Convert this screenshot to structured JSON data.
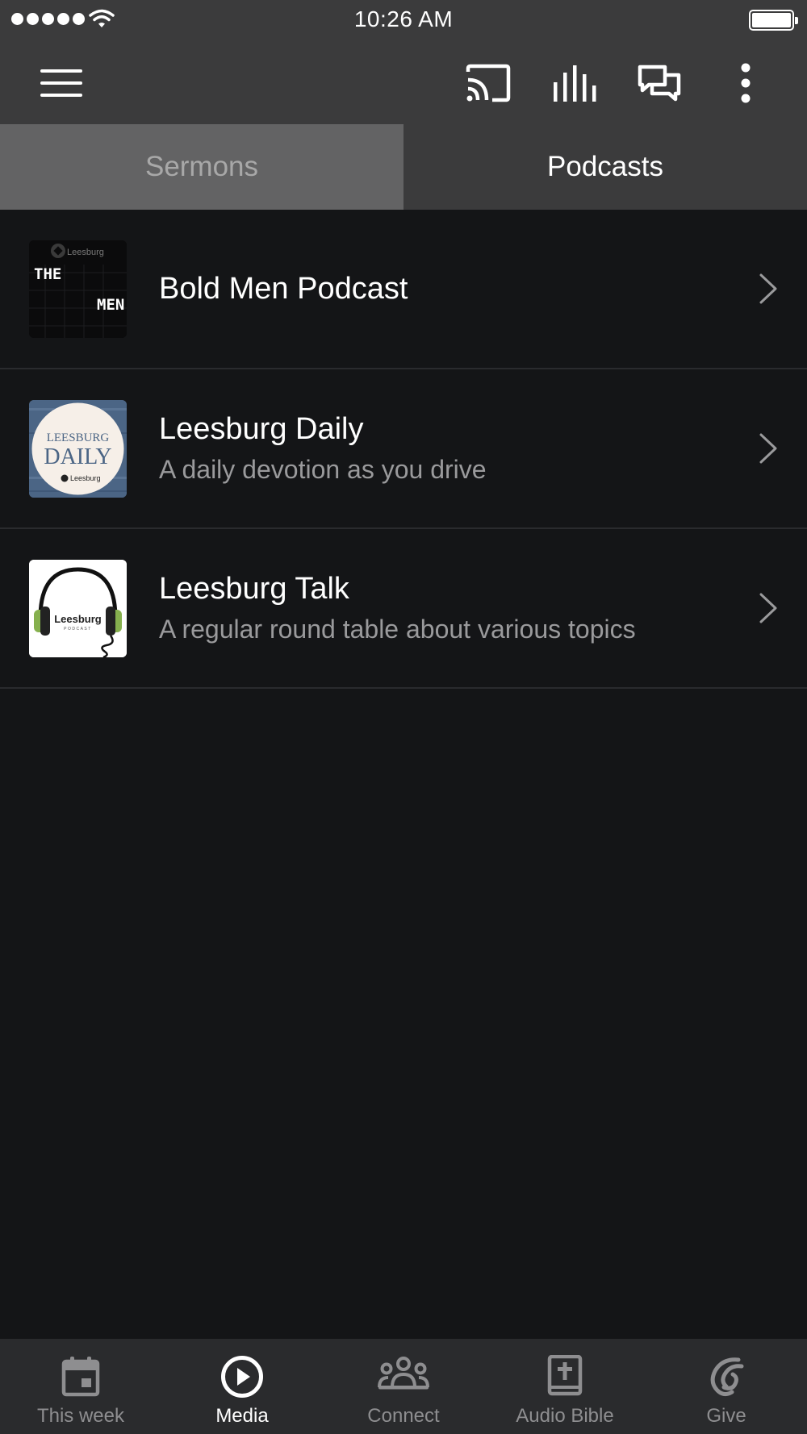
{
  "status_bar": {
    "time": "10:26 AM"
  },
  "toolbar": {
    "menu_icon": "hamburger-menu-icon",
    "cast_icon": "cast-icon",
    "audio_icon": "audio-bars-icon",
    "chat_icon": "chat-bubbles-icon",
    "more_icon": "more-vertical-icon"
  },
  "tabs": [
    {
      "label": "Sermons",
      "active": false
    },
    {
      "label": "Podcasts",
      "active": true
    }
  ],
  "podcasts": [
    {
      "title": "Bold Men Podcast",
      "subtitle": "",
      "artwork": {
        "top_text": "Leesburg",
        "line1": "THE",
        "line2": "MEN"
      }
    },
    {
      "title": "Leesburg Daily",
      "subtitle": "A daily devotion as you drive",
      "artwork": {
        "line1": "LEESBURG",
        "line2": "DAILY",
        "footer": "Leesburg"
      }
    },
    {
      "title": "Leesburg Talk",
      "subtitle": "A regular round table about various topics",
      "artwork": {
        "line1": "Leesburg",
        "line2": "PODCAST"
      }
    }
  ],
  "bottom_nav": [
    {
      "label": "This week",
      "icon": "calendar-icon",
      "selected": false
    },
    {
      "label": "Media",
      "icon": "play-circle-icon",
      "selected": true
    },
    {
      "label": "Connect",
      "icon": "people-group-icon",
      "selected": false
    },
    {
      "label": "Audio Bible",
      "icon": "bible-icon",
      "selected": false
    },
    {
      "label": "Give",
      "icon": "give-hand-icon",
      "selected": false
    }
  ],
  "colors": {
    "background": "#141517",
    "bar": "#3b3b3c",
    "tab_inactive": "#636364",
    "subtitle": "#9a9a9c",
    "bottom_bar": "#2a2b2d"
  }
}
